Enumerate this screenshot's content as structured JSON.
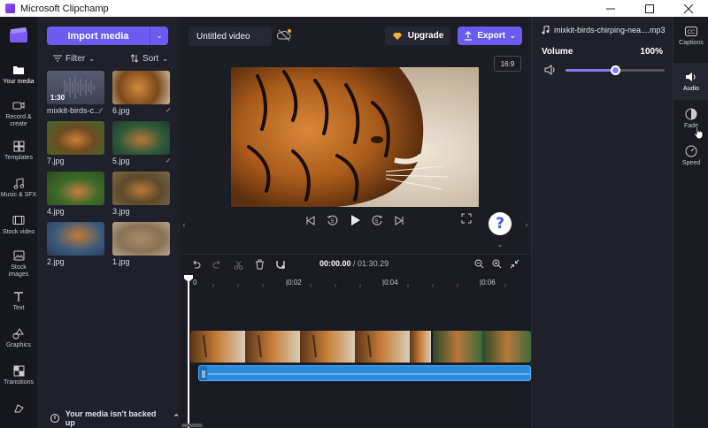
{
  "window": {
    "title": "Microsoft Clipchamp",
    "controls": [
      "minimize",
      "maximize",
      "close"
    ]
  },
  "leftnav": {
    "items": [
      {
        "label": "Your media",
        "icon": "folder-icon",
        "active": true
      },
      {
        "label": "Record & create",
        "icon": "camera-icon"
      },
      {
        "label": "Templates",
        "icon": "templates-icon"
      },
      {
        "label": "Music & SFX",
        "icon": "music-icon"
      },
      {
        "label": "Stock video",
        "icon": "film-icon"
      },
      {
        "label": "Stock images",
        "icon": "image-icon"
      },
      {
        "label": "Text",
        "icon": "text-icon"
      },
      {
        "label": "Graphics",
        "icon": "shapes-icon"
      },
      {
        "label": "Transitions",
        "icon": "transitions-icon"
      },
      {
        "label": "",
        "icon": "brand-kit-icon"
      }
    ]
  },
  "media": {
    "import_label": "Import media",
    "filter_label": "Filter",
    "sort_label": "Sort",
    "items": [
      {
        "label": "mixkit-birds-c...",
        "type": "audio",
        "duration": "1:30",
        "checked": true
      },
      {
        "label": "6.jpg",
        "checked": true
      },
      {
        "label": "7.jpg"
      },
      {
        "label": "5.jpg",
        "checked": true
      },
      {
        "label": "4.jpg"
      },
      {
        "label": "3.jpg"
      },
      {
        "label": "2.jpg"
      },
      {
        "label": "1.jpg"
      }
    ],
    "backup_text": "Your media isn't backed up"
  },
  "editor": {
    "project_title": "Untitled video",
    "upgrade_label": "Upgrade",
    "export_label": "Export",
    "aspect_ratio": "16:9",
    "help_label": "?"
  },
  "timeline": {
    "current_time": "00:00.00",
    "separator": " / ",
    "total_time": "01:30.29",
    "ticks": [
      "0",
      "|0:02",
      "|0:04",
      "|0:06"
    ]
  },
  "properties": {
    "file_name": "mixkit-birds-chirping-nea....mp3",
    "volume_label": "Volume",
    "volume_value": "100%",
    "volume_level": 0.5
  },
  "righttabs": {
    "items": [
      {
        "label": "Captions",
        "icon": "captions-icon"
      },
      {
        "label": "Audio",
        "icon": "audio-icon",
        "active": true
      },
      {
        "label": "Fade",
        "icon": "fade-icon"
      },
      {
        "label": "Speed",
        "icon": "speed-icon"
      }
    ]
  },
  "colors": {
    "accent": "#6b5bf0",
    "audio_track": "#2e8bdc",
    "background": "#1c1c24"
  }
}
